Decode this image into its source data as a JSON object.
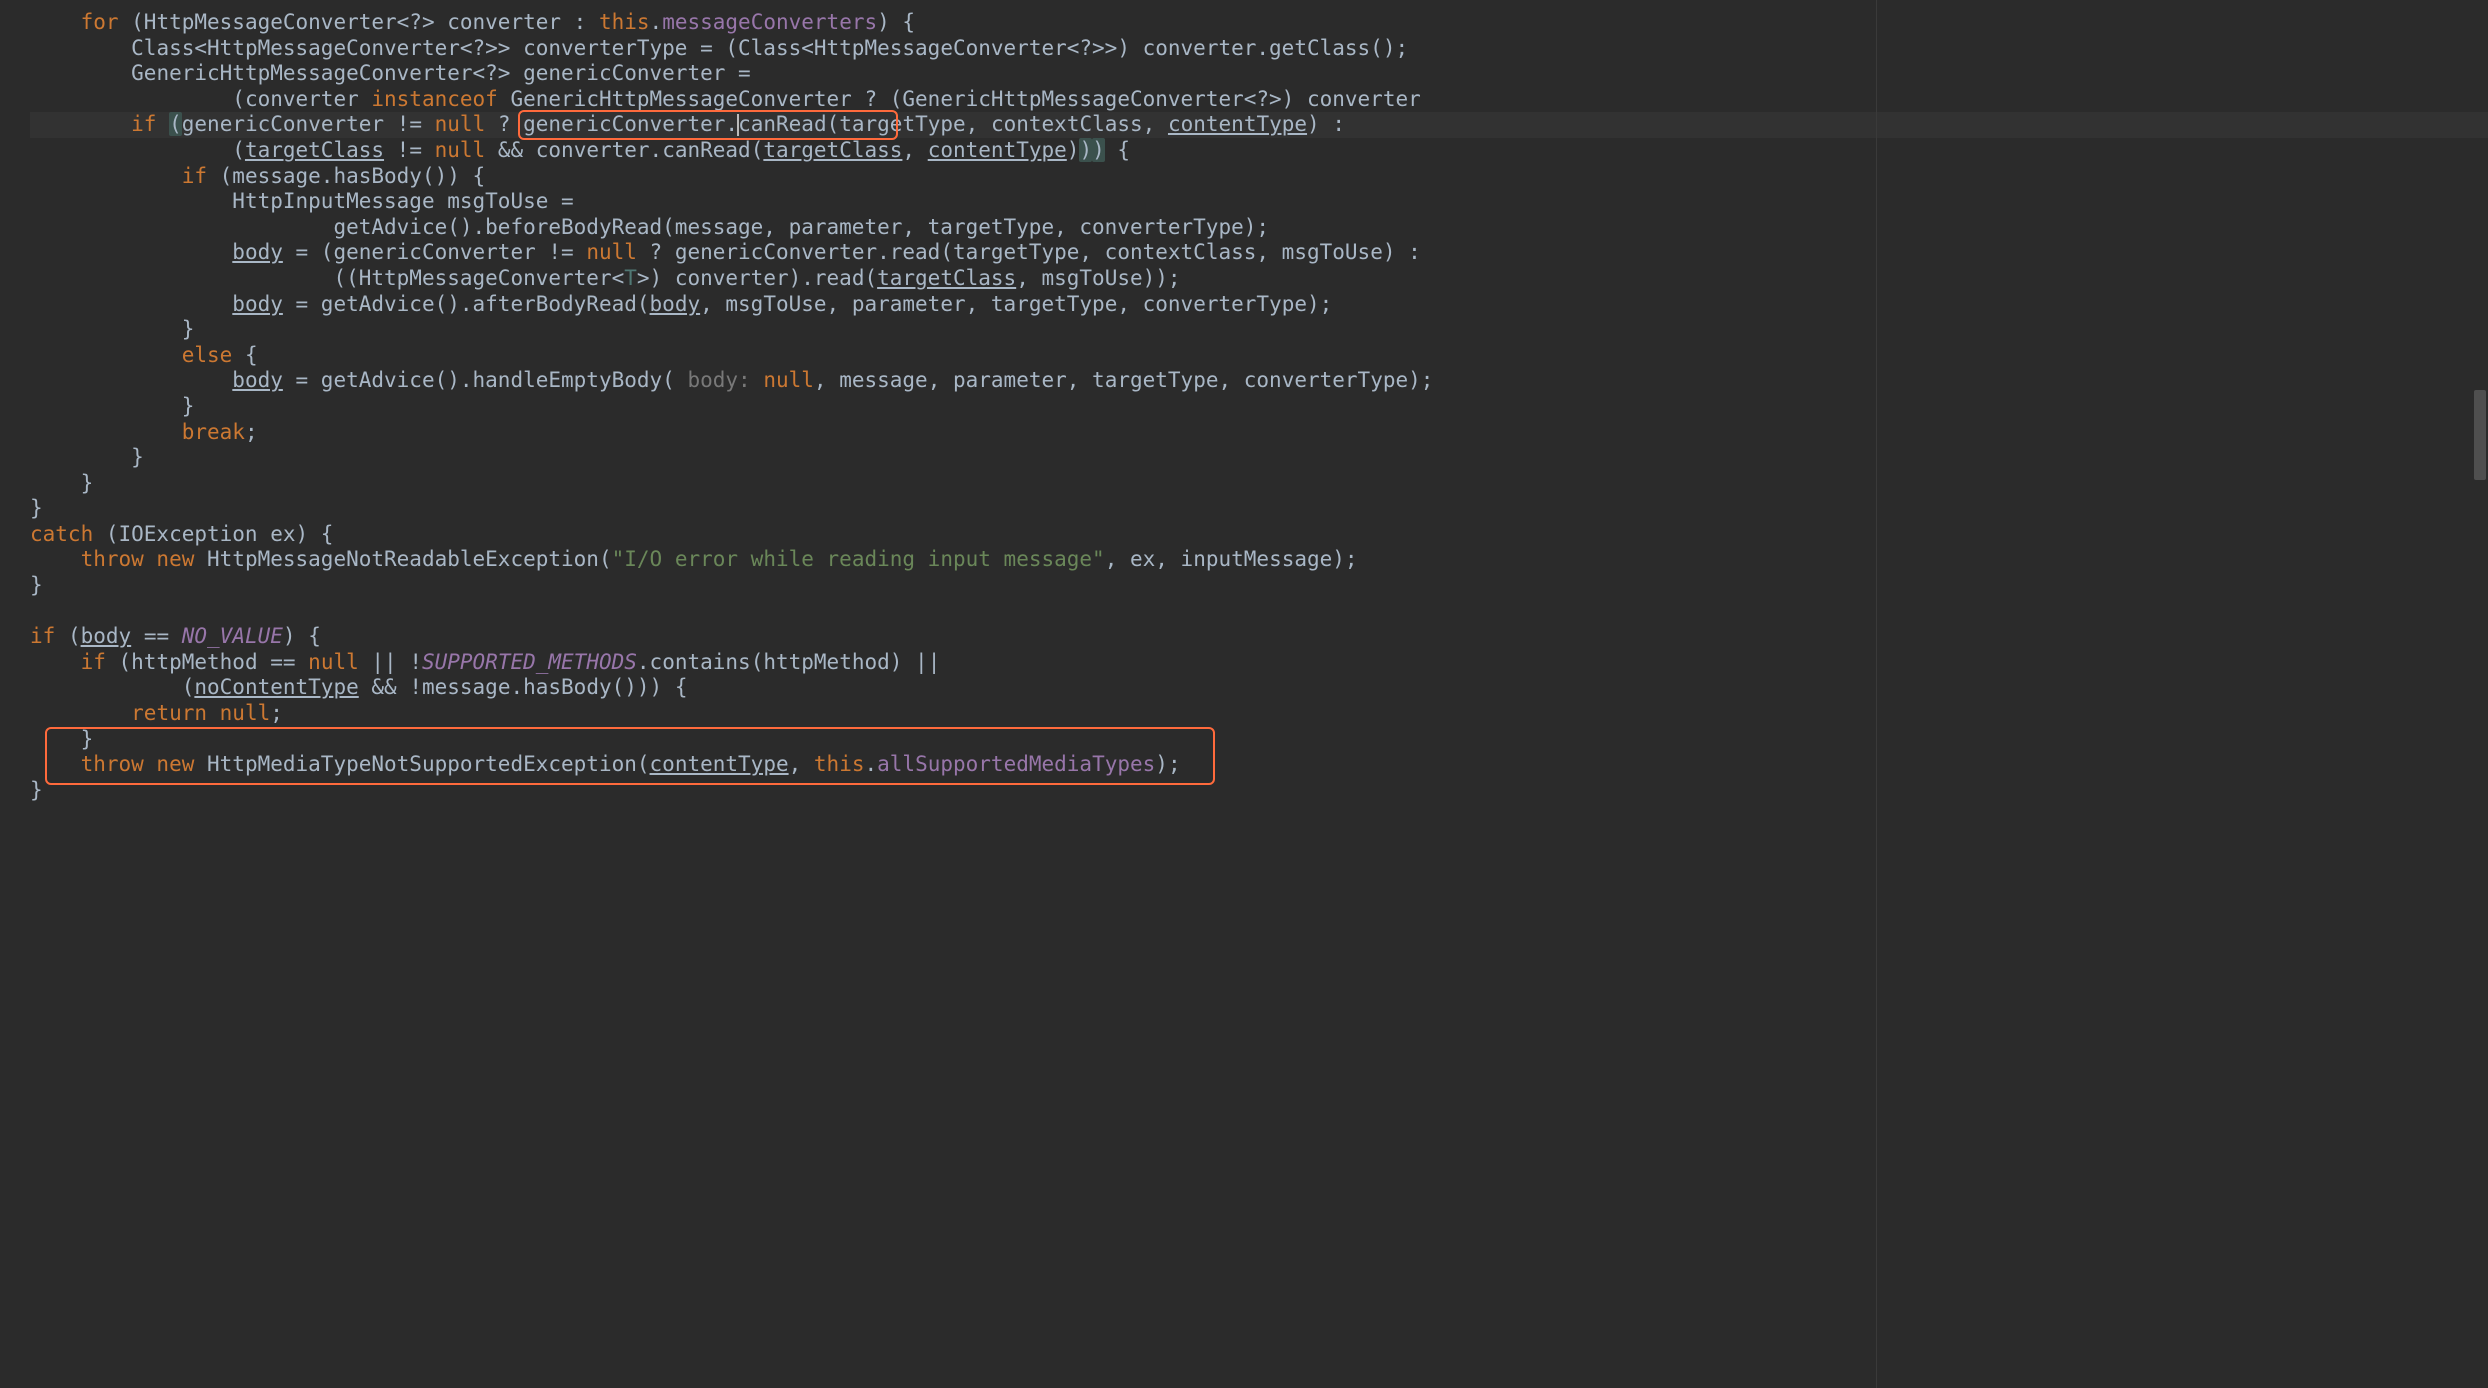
{
  "lang": "java",
  "colors": {
    "background": "#2b2b2b",
    "text": "#a9b7c6",
    "keyword": "#cc7832",
    "string": "#6a8759",
    "field": "#9876aa",
    "typeparam": "#507874",
    "paramhint": "#787878",
    "bracematch": "#3b514d",
    "highlight_border": "#ff6a3c",
    "current_line": "#323232"
  },
  "caret": {
    "line_index": 4,
    "after_token": "genericConverter_dot"
  },
  "highlight_boxes": [
    {
      "name": "canRead-call-highlight",
      "line_index": 4,
      "approx_text": "genericConverter.canRead(ta"
    },
    {
      "name": "throw-unsupported-highlight",
      "line_indices": [
        28,
        29
      ],
      "approx_text": "}\\n    throw new HttpMediaTypeNotSupportedException(contentType, this.allSupportedMediaTypes);"
    }
  ],
  "lines": [
    {
      "indent": 4,
      "tokens": [
        {
          "t": "for",
          "c": "kw"
        },
        {
          "t": " (HttpMessageConverter<?> converter : "
        },
        {
          "t": "this",
          "c": "kw"
        },
        {
          "t": "."
        },
        {
          "t": "messageConverters",
          "c": "field"
        },
        {
          "t": ") {"
        }
      ]
    },
    {
      "indent": 8,
      "tokens": [
        {
          "t": "Class<HttpMessageConverter<?>> converterType = (Class<HttpMessageConverter<?>>) converter.getClass();"
        }
      ]
    },
    {
      "indent": 8,
      "tokens": [
        {
          "t": "GenericHttpMessageConverter<?> genericConverter ="
        }
      ]
    },
    {
      "indent": 16,
      "tokens": [
        {
          "t": "(converter "
        },
        {
          "t": "instanceof",
          "c": "kw"
        },
        {
          "t": " GenericHttpMessageConverter ? (GenericHttpMessageConverter<?>) converter"
        }
      ]
    },
    {
      "indent": 8,
      "current": true,
      "tokens": [
        {
          "t": "if",
          "c": "kw"
        },
        {
          "t": " "
        },
        {
          "t": "(",
          "c": "brace-match"
        },
        {
          "t": "genericConverter != "
        },
        {
          "t": "null",
          "c": "kw"
        },
        {
          "t": " ? genericConverter."
        },
        {
          "caret": true
        },
        {
          "t": "canRead(targetType, contextClass, "
        },
        {
          "t": "contentType",
          "c": "underline"
        },
        {
          "t": ") :"
        }
      ]
    },
    {
      "indent": 16,
      "tokens": [
        {
          "t": "("
        },
        {
          "t": "targetClass",
          "c": "underline"
        },
        {
          "t": " != "
        },
        {
          "t": "null",
          "c": "kw"
        },
        {
          "t": " && converter.canRead("
        },
        {
          "t": "targetClass",
          "c": "underline"
        },
        {
          "t": ", "
        },
        {
          "t": "contentType",
          "c": "underline"
        },
        {
          "t": ")"
        },
        {
          "t": ")",
          "c": "brace-match"
        },
        {
          "t": ")",
          "c": "brace-match"
        },
        {
          "t": " {"
        }
      ]
    },
    {
      "indent": 12,
      "tokens": [
        {
          "t": "if",
          "c": "kw"
        },
        {
          "t": " (message.hasBody()) {"
        }
      ]
    },
    {
      "indent": 16,
      "tokens": [
        {
          "t": "HttpInputMessage msgToUse ="
        }
      ]
    },
    {
      "indent": 24,
      "tokens": [
        {
          "t": "getAdvice().beforeBodyRead(message, parameter, targetType, converterType);"
        }
      ]
    },
    {
      "indent": 16,
      "tokens": [
        {
          "t": "body",
          "c": "underline"
        },
        {
          "t": " = (genericConverter != "
        },
        {
          "t": "null",
          "c": "kw"
        },
        {
          "t": " ? genericConverter.read(targetType, contextClass, msgToUse) :"
        }
      ]
    },
    {
      "indent": 24,
      "tokens": [
        {
          "t": "((HttpMessageConverter<"
        },
        {
          "t": "T",
          "c": "typeparam"
        },
        {
          "t": ">) converter).read("
        },
        {
          "t": "targetClass",
          "c": "underline"
        },
        {
          "t": ", msgToUse));"
        }
      ]
    },
    {
      "indent": 16,
      "tokens": [
        {
          "t": "body",
          "c": "underline"
        },
        {
          "t": " = getAdvice().afterBodyRead("
        },
        {
          "t": "body",
          "c": "underline"
        },
        {
          "t": ", msgToUse, parameter, targetType, converterType);"
        }
      ]
    },
    {
      "indent": 12,
      "tokens": [
        {
          "t": "}"
        }
      ]
    },
    {
      "indent": 12,
      "tokens": [
        {
          "t": "else",
          "c": "kw"
        },
        {
          "t": " {"
        }
      ]
    },
    {
      "indent": 16,
      "tokens": [
        {
          "t": "body",
          "c": "underline"
        },
        {
          "t": " = getAdvice().handleEmptyBody( "
        },
        {
          "t": "body:",
          "c": "paramhint"
        },
        {
          "t": " "
        },
        {
          "t": "null",
          "c": "kw"
        },
        {
          "t": ", message, parameter, targetType, converterType);"
        }
      ]
    },
    {
      "indent": 12,
      "tokens": [
        {
          "t": "}"
        }
      ]
    },
    {
      "indent": 12,
      "tokens": [
        {
          "t": "break",
          "c": "kw"
        },
        {
          "t": ";"
        }
      ]
    },
    {
      "indent": 8,
      "tokens": [
        {
          "t": "}"
        }
      ]
    },
    {
      "indent": 4,
      "tokens": [
        {
          "t": "}"
        }
      ]
    },
    {
      "indent": 0,
      "tokens": [
        {
          "t": "}"
        }
      ]
    },
    {
      "indent": 0,
      "tokens": [
        {
          "t": "catch",
          "c": "kw"
        },
        {
          "t": " (IOException ex) {"
        }
      ]
    },
    {
      "indent": 4,
      "tokens": [
        {
          "t": "throw new",
          "c": "kw"
        },
        {
          "t": " HttpMessageNotReadableException("
        },
        {
          "t": "\"I/O error while reading input message\"",
          "c": "str"
        },
        {
          "t": ", ex, inputMessage);"
        }
      ]
    },
    {
      "indent": 0,
      "tokens": [
        {
          "t": "}"
        }
      ]
    },
    {
      "indent": 0,
      "tokens": [
        {
          "t": ""
        }
      ]
    },
    {
      "indent": 0,
      "tokens": [
        {
          "t": "if",
          "c": "kw"
        },
        {
          "t": " ("
        },
        {
          "t": "body",
          "c": "underline"
        },
        {
          "t": " == "
        },
        {
          "t": "NO_VALUE",
          "c": "static"
        },
        {
          "t": ") {"
        }
      ]
    },
    {
      "indent": 4,
      "tokens": [
        {
          "t": "if",
          "c": "kw"
        },
        {
          "t": " (httpMethod == "
        },
        {
          "t": "null",
          "c": "kw"
        },
        {
          "t": " || !"
        },
        {
          "t": "SUPPORTED_METHODS",
          "c": "static"
        },
        {
          "t": ".contains(httpMethod) ||"
        }
      ]
    },
    {
      "indent": 12,
      "tokens": [
        {
          "t": "("
        },
        {
          "t": "noContentType",
          "c": "underline"
        },
        {
          "t": " && !message.hasBody())) {"
        }
      ]
    },
    {
      "indent": 8,
      "tokens": [
        {
          "t": "return null",
          "c": "kw"
        },
        {
          "t": ";"
        }
      ]
    },
    {
      "indent": 4,
      "tokens": [
        {
          "t": "}"
        }
      ]
    },
    {
      "indent": 4,
      "tokens": [
        {
          "t": "throw new",
          "c": "kw"
        },
        {
          "t": " HttpMediaTypeNotSupportedException("
        },
        {
          "t": "contentType",
          "c": "underline"
        },
        {
          "t": ", "
        },
        {
          "t": "this",
          "c": "kw"
        },
        {
          "t": "."
        },
        {
          "t": "allSupportedMediaTypes",
          "c": "field"
        },
        {
          "t": ");"
        }
      ]
    },
    {
      "indent": 0,
      "tokens": [
        {
          "t": "}"
        }
      ]
    }
  ]
}
